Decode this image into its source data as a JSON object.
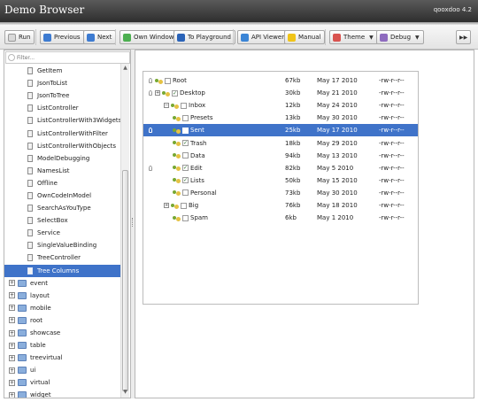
{
  "app": {
    "title": "Demo Browser",
    "version": "qooxdoo 4.2"
  },
  "toolbar": {
    "run": "Run",
    "previous": "Previous",
    "next": "Next",
    "own_window": "Own Window",
    "to_playground": "To Playground",
    "api_viewer": "API Viewer",
    "manual": "Manual",
    "theme": "Theme",
    "debug": "Debug"
  },
  "filter": {
    "placeholder": "Filter..."
  },
  "sidebar": {
    "leaves": [
      "GetItem",
      "JsonToList",
      "JsonToTree",
      "ListController",
      "ListControllerWith3Widgets",
      "ListControllerWithFilter",
      "ListControllerWithObjects",
      "ModelDebugging",
      "NamesList",
      "Offline",
      "OwnCodeInModel",
      "SearchAsYouType",
      "SelectBox",
      "Service",
      "SingleValueBinding",
      "TreeController",
      "Tree Columns"
    ],
    "selected_leaf": "Tree Columns",
    "categories": [
      "event",
      "layout",
      "mobile",
      "root",
      "showcase",
      "table",
      "treevirtual",
      "ui",
      "virtual",
      "widget"
    ]
  },
  "filetree": {
    "rows": [
      {
        "name": "Root",
        "size": "67kb",
        "date": "May 17 2010",
        "perm": "-rw-r--r--",
        "depth": 0,
        "expand": "",
        "checked": false,
        "bulb": true,
        "selected": false
      },
      {
        "name": "Desktop",
        "size": "30kb",
        "date": "May 21 2010",
        "perm": "-rw-r--r--",
        "depth": 0,
        "expand": "+",
        "checked": true,
        "bulb": true,
        "selected": false
      },
      {
        "name": "Inbox",
        "size": "12kb",
        "date": "May 24 2010",
        "perm": "-rw-r--r--",
        "depth": 1,
        "expand": "−",
        "checked": false,
        "bulb": false,
        "selected": false
      },
      {
        "name": "Presets",
        "size": "13kb",
        "date": "May 30 2010",
        "perm": "-rw-r--r--",
        "depth": 2,
        "expand": "",
        "checked": false,
        "bulb": false,
        "selected": false
      },
      {
        "name": "Sent",
        "size": "25kb",
        "date": "May 17 2010",
        "perm": "-rw-r--r--",
        "depth": 2,
        "expand": "",
        "checked": false,
        "bulb": true,
        "selected": true
      },
      {
        "name": "Trash",
        "size": "18kb",
        "date": "May 29 2010",
        "perm": "-rw-r--r--",
        "depth": 2,
        "expand": "",
        "checked": true,
        "bulb": false,
        "selected": false
      },
      {
        "name": "Data",
        "size": "94kb",
        "date": "May 13 2010",
        "perm": "-rw-r--r--",
        "depth": 2,
        "expand": "",
        "checked": false,
        "bulb": false,
        "selected": false
      },
      {
        "name": "Edit",
        "size": "82kb",
        "date": "May 5 2010",
        "perm": "-rw-r--r--",
        "depth": 2,
        "expand": "",
        "checked": true,
        "bulb": true,
        "selected": false
      },
      {
        "name": "Lists",
        "size": "50kb",
        "date": "May 15 2010",
        "perm": "-rw-r--r--",
        "depth": 2,
        "expand": "",
        "checked": true,
        "bulb": false,
        "selected": false
      },
      {
        "name": "Personal",
        "size": "73kb",
        "date": "May 30 2010",
        "perm": "-rw-r--r--",
        "depth": 2,
        "expand": "",
        "checked": false,
        "bulb": false,
        "selected": false
      },
      {
        "name": "Big",
        "size": "76kb",
        "date": "May 18 2010",
        "perm": "-rw-r--r--",
        "depth": 1,
        "expand": "+",
        "checked": false,
        "bulb": false,
        "selected": false
      },
      {
        "name": "Spam",
        "size": "6kb",
        "date": "May 1 2010",
        "perm": "-rw-r--r--",
        "depth": 2,
        "expand": "",
        "checked": false,
        "bulb": false,
        "selected": false
      }
    ]
  },
  "colors": {
    "selection": "#3f73c9",
    "titlebar": "#3a3a3a"
  },
  "icons": [
    "run-icon",
    "previous-icon",
    "next-icon",
    "own-window-icon",
    "playground-icon",
    "api-viewer-icon",
    "manual-icon",
    "theme-icon",
    "debug-icon",
    "search-icon",
    "file-icon",
    "folder-icon",
    "lightbulb-icon",
    "group-icon"
  ]
}
